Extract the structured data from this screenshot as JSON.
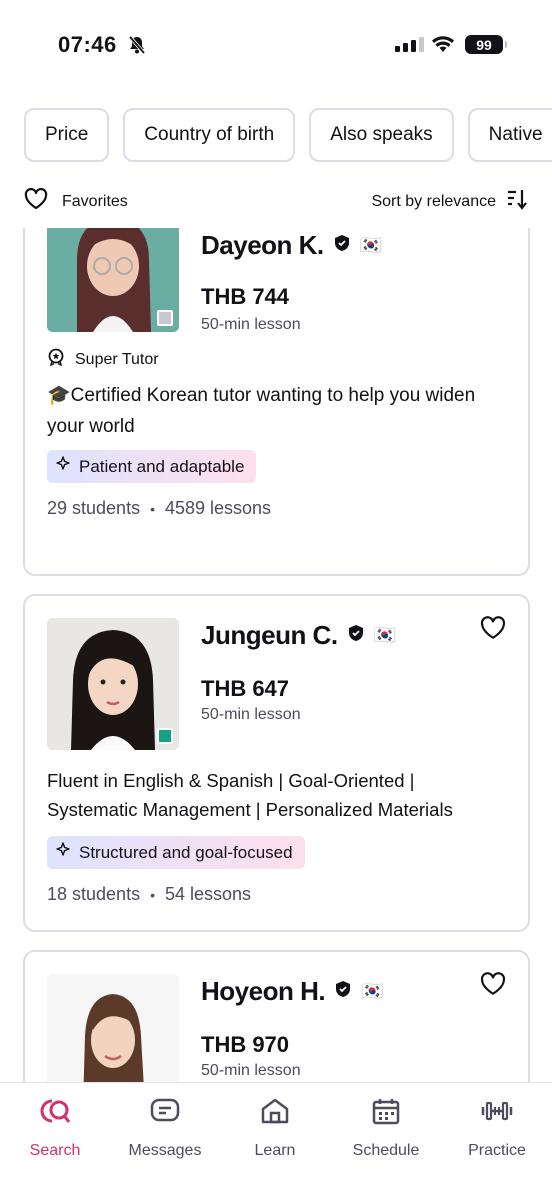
{
  "status_bar": {
    "time": "07:46",
    "battery": "99"
  },
  "filters": [
    "Price",
    "Country of birth",
    "Also speaks",
    "Native"
  ],
  "subheader": {
    "favorites_label": "Favorites",
    "sort_label": "Sort by relevance"
  },
  "tutors": [
    {
      "name": "Dayeon K.",
      "flag": "🇰🇷",
      "price": "THB 744",
      "lesson": "50-min lesson",
      "badge": "Super Tutor",
      "headline": "🎓Certified Korean tutor wanting to help you widen your world",
      "tag": "Patient and adaptable",
      "students": "29 students",
      "lessons": "4589 lessons",
      "online_color": "#c8c8d0"
    },
    {
      "name": "Jungeun C.",
      "flag": "🇰🇷",
      "price": "THB 647",
      "lesson": "50-min lesson",
      "headline": "Fluent in English & Spanish | Goal-Oriented | Systematic Management | Personalized Materials",
      "tag": "Structured and goal-focused",
      "students": "18 students",
      "lessons": "54 lessons",
      "online_color": "#16a085"
    },
    {
      "name": "Hoyeon H.",
      "flag": "🇰🇷",
      "price": "THB 970",
      "lesson": "50-min lesson"
    }
  ],
  "nav": [
    {
      "label": "Search",
      "icon": "search-icon",
      "active": true
    },
    {
      "label": "Messages",
      "icon": "messages-icon"
    },
    {
      "label": "Learn",
      "icon": "home-icon"
    },
    {
      "label": "Schedule",
      "icon": "calendar-icon"
    },
    {
      "label": "Practice",
      "icon": "dumbbell-icon"
    }
  ],
  "colors": {
    "accent": "#d62e6c",
    "border": "#dcdce5",
    "text": "#121117",
    "muted": "#4d4c5c"
  }
}
